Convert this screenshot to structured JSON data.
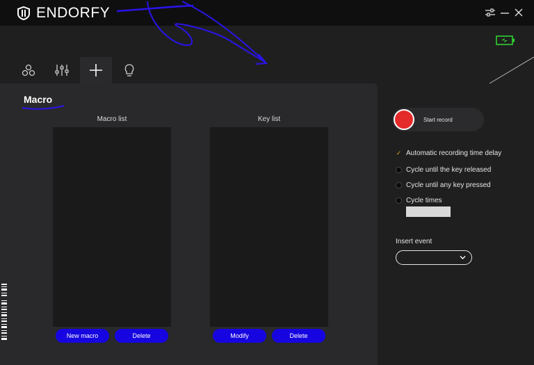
{
  "app": {
    "brand": "ENDORFY"
  },
  "tabs": [
    {
      "icon": "circles-icon",
      "active": false
    },
    {
      "icon": "sliders-icon",
      "active": false
    },
    {
      "icon": "plus-icon",
      "active": true
    },
    {
      "icon": "lightbulb-icon",
      "active": false
    }
  ],
  "macro": {
    "title": "Macro",
    "macro_list_label": "Macro list",
    "key_list_label": "Key list",
    "new_macro_label": "New macro",
    "delete_macro_label": "Delete",
    "modify_label": "Modify",
    "delete_key_label": "Delete"
  },
  "record": {
    "start_label": "Start record",
    "options": [
      {
        "label": "Automatic recording time delay",
        "selected": true
      },
      {
        "label": "Cycle until the key released",
        "selected": false
      },
      {
        "label": "Cycle until any key pressed",
        "selected": false
      },
      {
        "label": "Cycle times",
        "selected": false
      }
    ],
    "cycle_times_value": ""
  },
  "insert_event": {
    "label": "Insert event",
    "selected": ""
  },
  "colors": {
    "accent_blue": "#1605e0",
    "record_red": "#e52a2a",
    "battery_green": "#2fd12f",
    "check_orange": "#e0a31a"
  }
}
